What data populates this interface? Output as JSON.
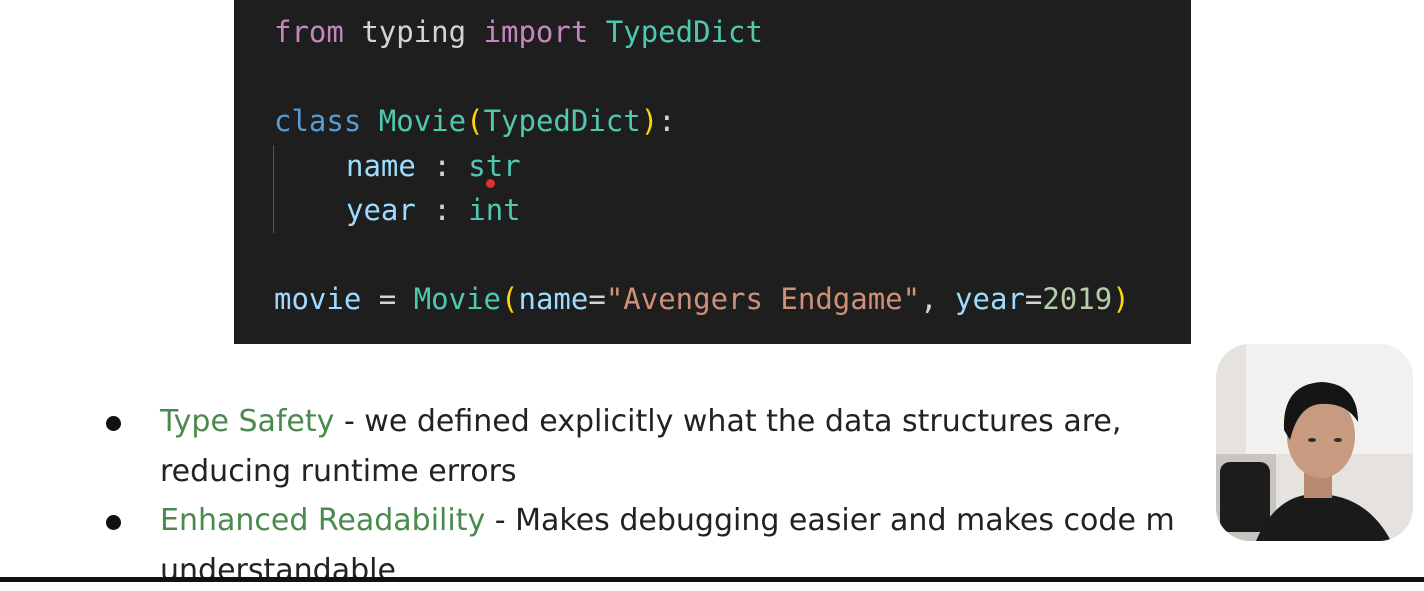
{
  "code": {
    "line1": {
      "kw": "from",
      "mod": "typing",
      "kw2": "import",
      "name": "TypedDict"
    },
    "line2": {
      "kw": "class",
      "name": "Movie",
      "open": "(",
      "base": "TypedDict",
      "close": ")",
      "colon": ":"
    },
    "line3": {
      "field": "name",
      "sep": ":",
      "type": "str"
    },
    "line4": {
      "field": "year",
      "sep": ":",
      "type": "int"
    },
    "line5": {
      "var": "movie",
      "eq": "=",
      "cls": "Movie",
      "open": "(",
      "arg1": "name",
      "eq1": "=",
      "val1": "\"Avengers Endgame\"",
      "comma": ",",
      "arg2": "year",
      "eq2": "=",
      "val2": "2019",
      "close": ")"
    }
  },
  "bullets": [
    {
      "term": "Type Safety",
      "text_line1": " - we defined explicitly what the data structures are,",
      "text_line2": "reducing runtime errors"
    },
    {
      "term": "Enhanced Readability",
      "text_line1": " - Makes debugging easier and makes code m",
      "text_line2": "understandable"
    }
  ],
  "colors": {
    "code_bg": "#1e1e1e",
    "keyword_purple": "#c586c0",
    "keyword_blue": "#569cd6",
    "class_teal": "#4ec9b0",
    "string_orange": "#ce9178",
    "number_green": "#b5cea8",
    "variable_blue": "#9cdcfe",
    "term_green": "#4a8a4e"
  },
  "webcam": {
    "icon": "person-video-feed"
  }
}
